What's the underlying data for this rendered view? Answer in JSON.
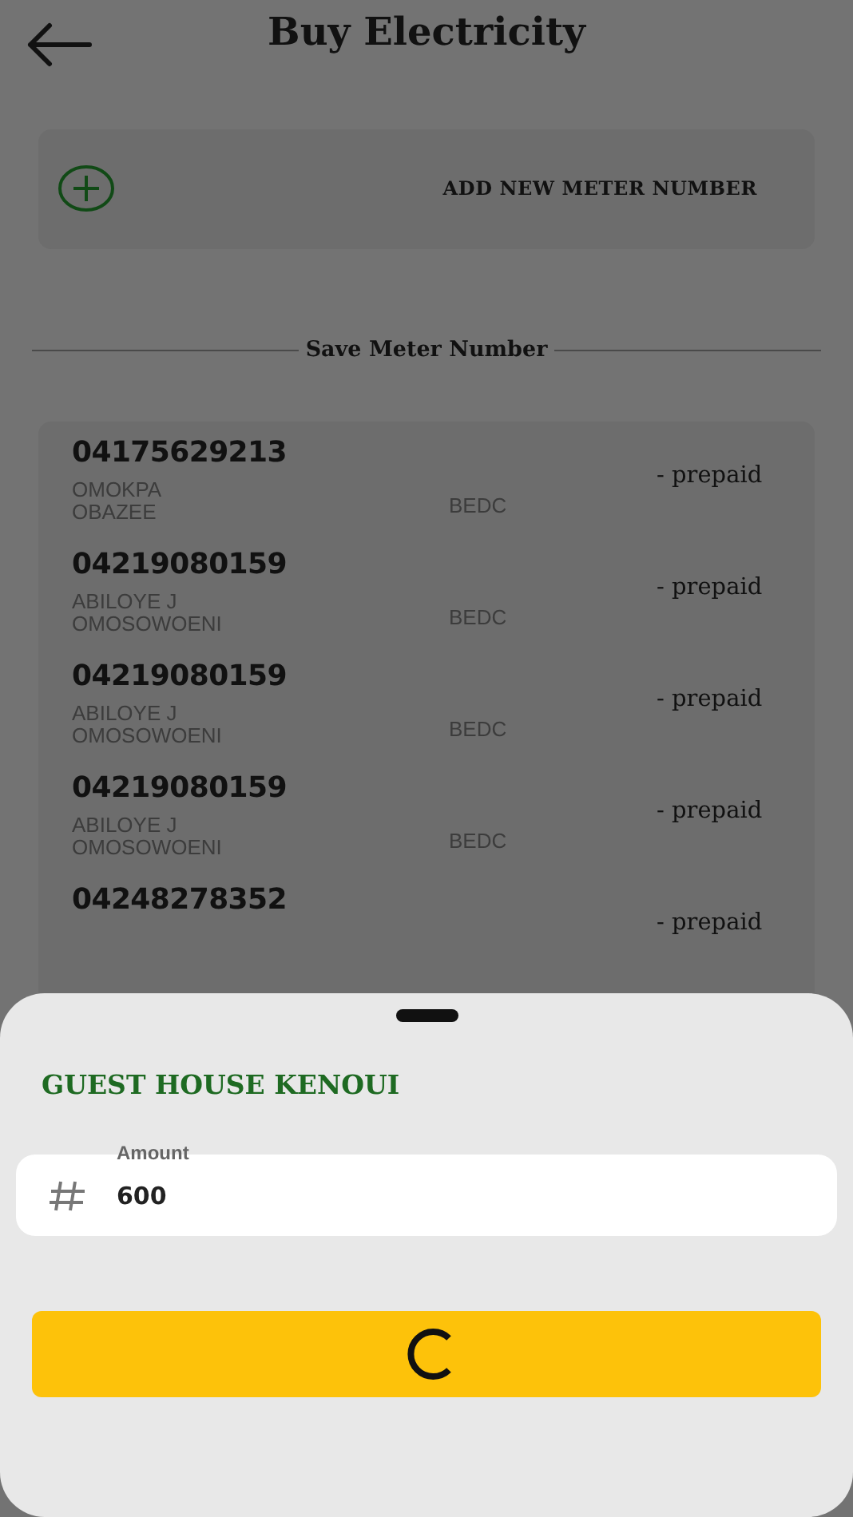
{
  "header": {
    "title": "Buy Electricity"
  },
  "add_meter": {
    "label": "ADD NEW METER NUMBER"
  },
  "section_title": "Save Meter Number",
  "meters": [
    {
      "number": "04175629213",
      "name": "OMOKPA\nOBAZEE",
      "disco": "BEDC",
      "type": "- prepaid"
    },
    {
      "number": "04219080159",
      "name": "ABILOYE  J\nOMOSOWOENI",
      "disco": "BEDC",
      "type": "- prepaid"
    },
    {
      "number": "04219080159",
      "name": "ABILOYE  J\nOMOSOWOENI",
      "disco": "BEDC",
      "type": "- prepaid"
    },
    {
      "number": "04219080159",
      "name": "ABILOYE  J\nOMOSOWOENI",
      "disco": "BEDC",
      "type": "- prepaid"
    },
    {
      "number": "04248278352",
      "type": "- prepaid"
    }
  ],
  "sheet": {
    "title": "GUEST HOUSE KENOUI",
    "amount": {
      "label": "Amount",
      "value": "600"
    },
    "submit": {
      "loading": true
    }
  }
}
